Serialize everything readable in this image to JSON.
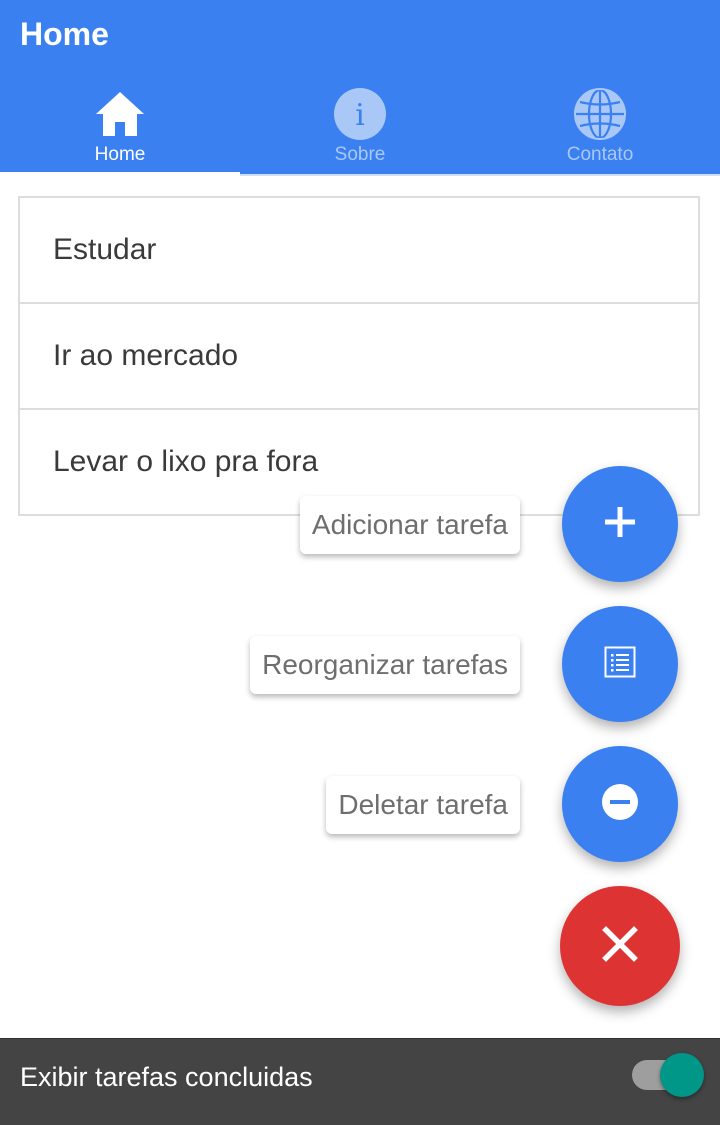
{
  "appbar": {
    "title": "Home",
    "color": "#3A80F0",
    "tabs": [
      {
        "label": "Home",
        "icon": "home-icon",
        "active": true
      },
      {
        "label": "Sobre",
        "icon": "info-icon",
        "active": false
      },
      {
        "label": "Contato",
        "icon": "globe-icon",
        "active": false
      }
    ]
  },
  "tasks": [
    {
      "title": "Estudar"
    },
    {
      "title": "Ir ao mercado"
    },
    {
      "title": "Levar o lixo pra fora"
    }
  ],
  "fab_menu": {
    "actions": [
      {
        "label": "Adicionar tarefa",
        "icon": "plus-icon"
      },
      {
        "label": "Reorganizar tarefas",
        "icon": "list-icon"
      },
      {
        "label": "Deletar tarefa",
        "icon": "minus-circle-icon"
      }
    ],
    "main_icon": "close-icon",
    "action_color": "#3A80F0",
    "main_color": "#DE3333"
  },
  "footer": {
    "label": "Exibir tarefas concluidas",
    "toggle_on": true,
    "toggle_color": "#009688"
  }
}
